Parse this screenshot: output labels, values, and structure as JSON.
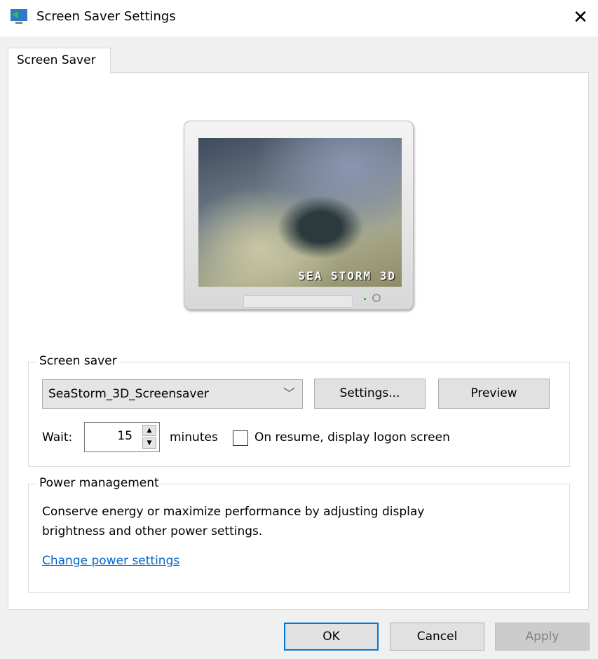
{
  "window": {
    "title": "Screen Saver Settings",
    "close": "✕",
    "icon": "screen-saver-app-icon"
  },
  "tab": {
    "label": "Screen Saver"
  },
  "preview": {
    "overlay_text": "SEA STORM 3D"
  },
  "screen_saver_group": {
    "legend": "Screen saver",
    "selected": "SeaStorm_3D_Screensaver",
    "dropdown_arrow": "﹀",
    "settings_label": "Settings...",
    "preview_label": "Preview",
    "wait_label": "Wait:",
    "wait_value": "15",
    "minutes_label": "minutes",
    "logon_label": "On resume, display logon screen",
    "logon_checked": false
  },
  "power_group": {
    "legend": "Power management",
    "line1": "Conserve energy or maximize performance by adjusting display",
    "line2": "brightness and other power settings.",
    "link": "Change power settings",
    "link_color": "#0066cc"
  },
  "footer": {
    "ok": "OK",
    "cancel": "Cancel",
    "apply": "Apply"
  },
  "colors": {
    "focus": "#0078d7"
  }
}
